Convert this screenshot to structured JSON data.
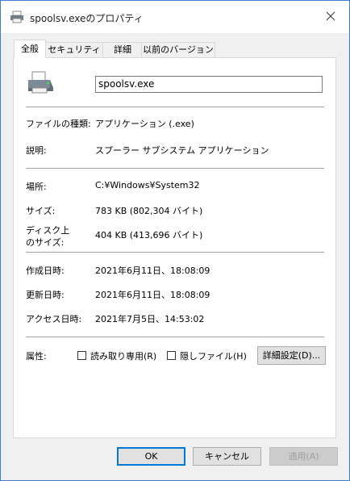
{
  "window": {
    "title": "spoolsv.exeのプロパティ"
  },
  "tabs": [
    {
      "label": "全般",
      "active": true
    },
    {
      "label": "セキュリティ",
      "active": false
    },
    {
      "label": "詳細",
      "active": false
    },
    {
      "label": "以前のバージョン",
      "active": false
    }
  ],
  "general": {
    "file_name": "spoolsv.exe",
    "file_type_label": "ファイルの種類:",
    "file_type_value": "アプリケーション (.exe)",
    "description_label": "説明:",
    "description_value": "スプーラー サブシステム アプリケーション",
    "location_label": "場所:",
    "location_value": "C:¥Windows¥System32",
    "size_label": "サイズ:",
    "size_value": "783 KB (802,304 バイト)",
    "disk_size_label_line1": "ディスク上",
    "disk_size_label_line2": "のサイズ:",
    "disk_size_value": "404 KB (413,696 バイト)",
    "created_label": "作成日時:",
    "created_value": "2021年6月11日、18:08:09",
    "modified_label": "更新日時:",
    "modified_value": "2021年6月11日、18:08:09",
    "accessed_label": "アクセス日時:",
    "accessed_value": "2021年7月5日、14:53:02",
    "attributes_label": "属性:",
    "readonly_label": "読み取り専用(R)",
    "readonly_checked": false,
    "hidden_label": "隠しファイル(H)",
    "hidden_checked": false,
    "advanced_button": "詳細設定(D)..."
  },
  "footer": {
    "ok": "OK",
    "cancel": "キャンセル",
    "apply": "適用(A)"
  },
  "icons": [
    "printer-icon",
    "close-icon"
  ]
}
